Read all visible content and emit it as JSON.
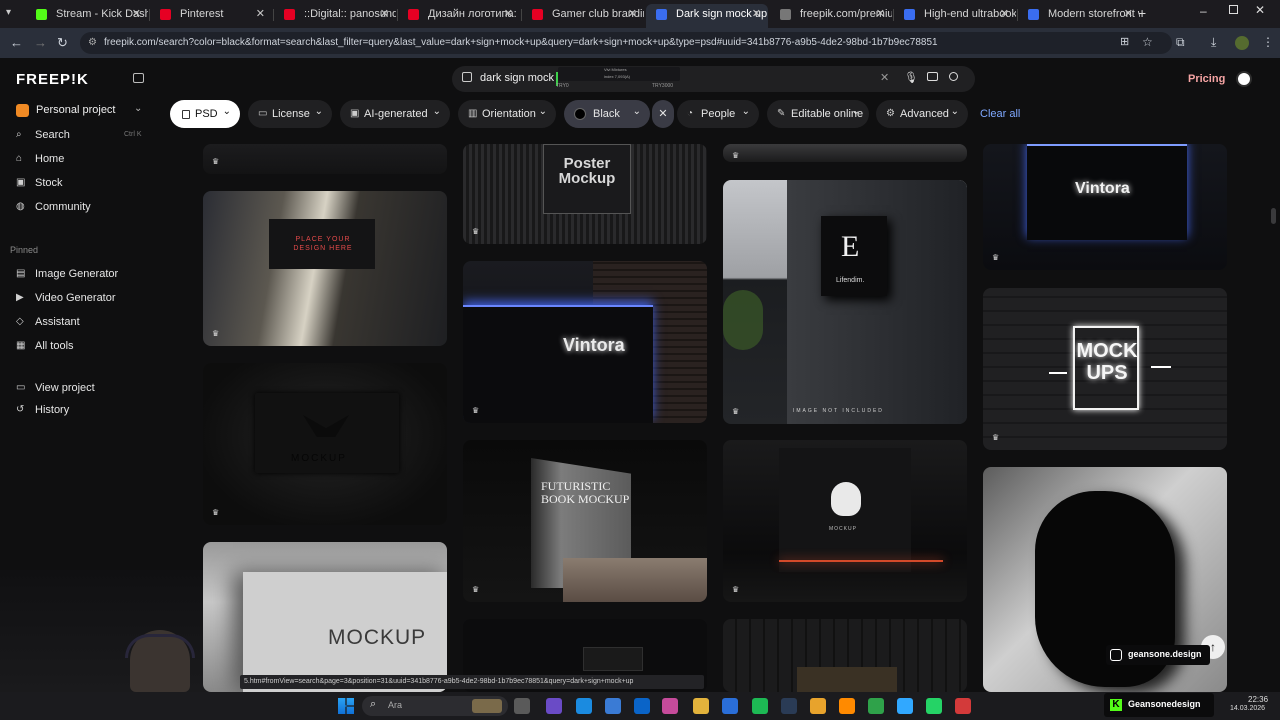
{
  "browser": {
    "tabs": [
      {
        "label": "Stream - Kick Dashbo",
        "color": "#53fc18"
      },
      {
        "label": "Pinterest",
        "color": "#e60023"
      },
      {
        "label": "::Digital:: panosunda",
        "color": "#e60023"
      },
      {
        "label": "Дизайн логотипа: Ci",
        "color": "#e60023"
      },
      {
        "label": "Gamer club branding",
        "color": "#e60023"
      },
      {
        "label": "Dark sign mock up P",
        "color": "#3a6df0"
      },
      {
        "label": "freepik.com/premiun",
        "color": "#777777"
      },
      {
        "label": "High-end ultrabook",
        "color": "#3a6df0"
      },
      {
        "label": "Modern storefront w",
        "color": "#3a6df0"
      }
    ],
    "url": "freepik.com/search?color=black&format=search&last_filter=query&last_value=dark+sign+mock+up&query=dark+sign+mock+up&type=psd#uuid=341b8776-a9b5-4de2-98bd-1b7b9ec78851",
    "status_url": "5.htm#fromView=search&page=3&position=31&uuid=341b8776-a9b5-4de2-98bd-1b7b9ec78851&query=dark+sign+mock+up"
  },
  "sidebar": {
    "logo": "FREEP!K",
    "project": "Personal project",
    "items": [
      {
        "label": "Search",
        "icon": "search-icon",
        "shortcut": "Ctrl K"
      },
      {
        "label": "Home",
        "icon": "home-icon"
      },
      {
        "label": "Stock",
        "icon": "stock-icon"
      },
      {
        "label": "Community",
        "icon": "globe-icon"
      }
    ],
    "pinned_label": "Pinned",
    "pinned": [
      {
        "label": "Image Generator",
        "icon": "image-icon"
      },
      {
        "label": "Video Generator",
        "icon": "video-icon"
      },
      {
        "label": "Assistant",
        "icon": "assistant-icon"
      },
      {
        "label": "All tools",
        "icon": "grid-icon"
      }
    ],
    "bottom": [
      {
        "label": "View project",
        "icon": "folder-icon"
      },
      {
        "label": "History",
        "icon": "history-icon"
      }
    ]
  },
  "search": {
    "query": "dark sign mock",
    "tooltip_title": "Vivi Mixtures",
    "tooltip_sub": "index 7,093(A)",
    "tick_left": "TRY0",
    "tick_right": "TRY3000"
  },
  "header": {
    "pricing": "Pricing"
  },
  "filters": [
    {
      "label": "PSD",
      "active": true
    },
    {
      "label": "License"
    },
    {
      "label": "AI-generated"
    },
    {
      "label": "Orientation"
    },
    {
      "label": "Black",
      "color": "#000000"
    },
    {
      "label": "People"
    },
    {
      "label": "Editable online"
    },
    {
      "label": "Advanced"
    }
  ],
  "clear_all": "Clear all",
  "grid": {
    "card_texts": {
      "poster": "Poster\nMockup",
      "place": "PLACE YOUR\nDESIGN HERE",
      "vintora": "Vintora",
      "lifendim": "Lifendim.",
      "image_not_included": "IMAGE NOT INCLUDED",
      "mockups": "MOCK\nUPS",
      "mockup": "MOCKUP",
      "book": "FUTURISTIC\nBOOK MOCKUP",
      "lion": "MOCKUP"
    }
  },
  "overlay": {
    "instagram": "geansone.design",
    "kick": "Geansonedesign"
  },
  "taskbar": {
    "search_placeholder": "Ara",
    "time": "22:36",
    "date": "14.03.2026"
  }
}
